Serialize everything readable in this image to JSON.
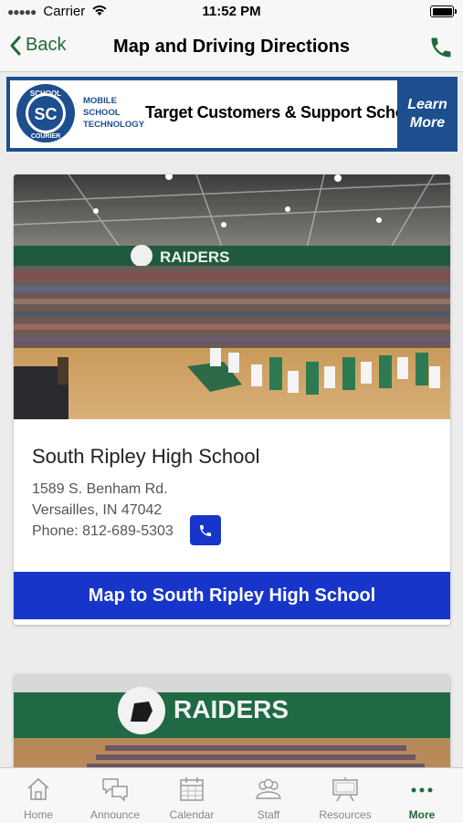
{
  "status_bar": {
    "carrier": "Carrier",
    "time": "11:52 PM"
  },
  "nav": {
    "back_label": "Back",
    "title": "Map and Driving Directions"
  },
  "banner": {
    "logo_top": "SCHOOL",
    "logo_mid": "SC",
    "logo_bottom": "COURIER",
    "mst_lines": [
      "MOBILE",
      "SCHOOL",
      "TECHNOLOGY"
    ],
    "tagline": "Target Customers & Support Schools",
    "learn_more_lines": [
      "Learn",
      "More"
    ]
  },
  "school": {
    "photo_banner": "RAIDERS",
    "name": "South Ripley High School",
    "address_line1": "1589 S. Benham Rd.",
    "address_line2": "Versailles, IN 47042",
    "phone": "Phone: 812-689-5303",
    "map_button": "Map to South Ripley High School"
  },
  "second_card": {
    "photo_banner": "RAIDERS"
  },
  "tabs": [
    {
      "label": "Home",
      "icon": "home-icon"
    },
    {
      "label": "Announce",
      "icon": "chat-bubbles-icon"
    },
    {
      "label": "Calendar",
      "icon": "calendar-icon"
    },
    {
      "label": "Staff",
      "icon": "people-icon"
    },
    {
      "label": "Resources",
      "icon": "easel-icon"
    },
    {
      "label": "More",
      "icon": "more-dots-icon"
    }
  ],
  "colors": {
    "accent_green": "#1f6b36",
    "button_blue": "#1736c9",
    "banner_blue": "#1d4e8e"
  }
}
